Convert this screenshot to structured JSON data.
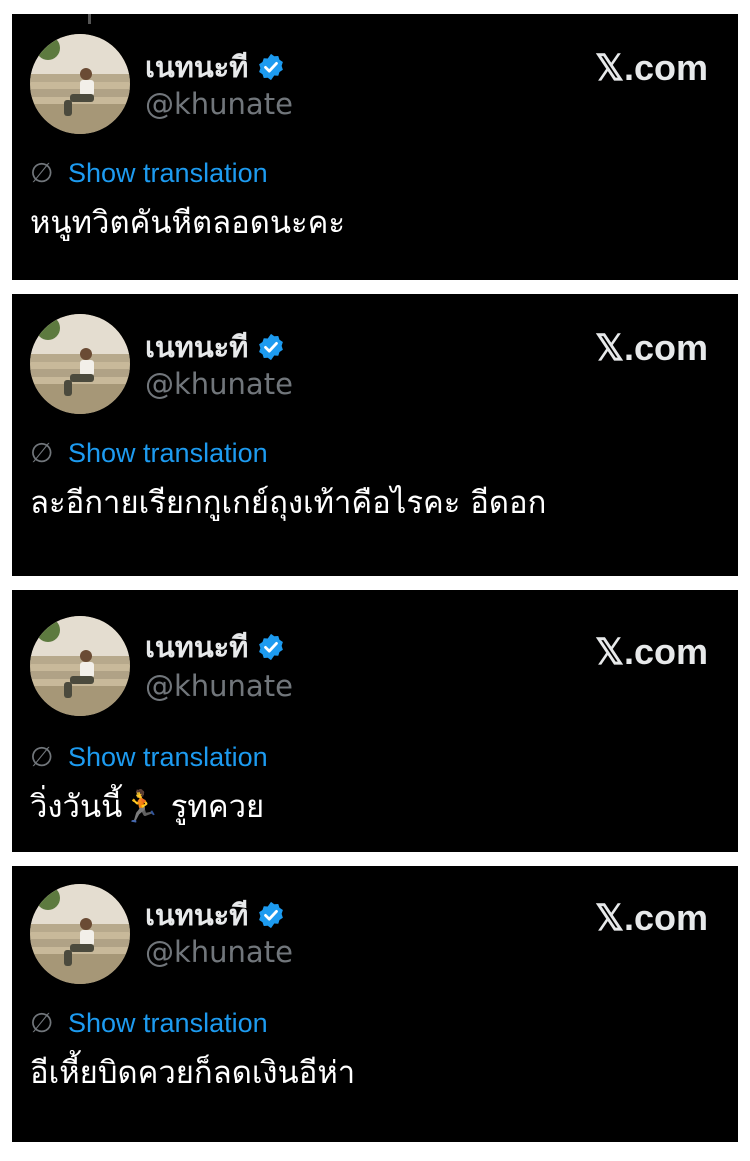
{
  "cards": [
    {
      "display_name": "เนทนะที",
      "handle": "@khunate",
      "brand": "𝕏.com",
      "translate_label": "Show translation",
      "tweet_text": "หนูทวิตคันหีตลอดนะคะ"
    },
    {
      "display_name": "เนทนะที",
      "handle": "@khunate",
      "brand": "𝕏.com",
      "translate_label": "Show translation",
      "tweet_text": "ละอีกายเรียกกูเกย์ถุงเท้าคือไรคะ อีดอก"
    },
    {
      "display_name": "เนทนะที",
      "handle": "@khunate",
      "brand": "𝕏.com",
      "translate_label": "Show translation",
      "tweet_text": "วิ่งวันนี้🏃 รูทควย"
    },
    {
      "display_name": "เนทนะที",
      "handle": "@khunate",
      "brand": "𝕏.com",
      "translate_label": "Show translation",
      "tweet_text": "อีเหี้ยบิดควยก็ลดเงินอีห่า"
    }
  ],
  "colors": {
    "card_bg": "#000000",
    "name": "#e7e9ea",
    "handle": "#71767b",
    "link": "#1d9bf0",
    "verified": "#1d9bf0"
  },
  "icons": {
    "verified": "verified-badge-icon",
    "translate": "translate-globe-icon"
  }
}
